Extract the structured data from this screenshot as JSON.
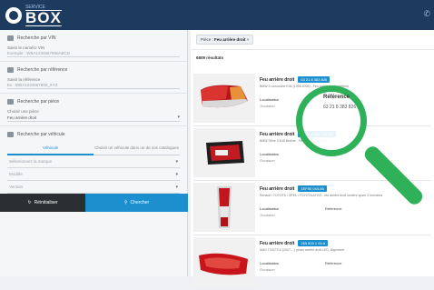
{
  "header": {
    "brand_small": "SERVICE",
    "brand": "BOX",
    "right_icon": "phone-icon"
  },
  "sidebar": {
    "vin": {
      "title": "Recherche par VIN",
      "label": "Saisir le numéro VIN",
      "placeholder": "Exemple : WBA1234567890ABCD"
    },
    "ref": {
      "title": "Recherche par référence",
      "label": "Saisir la référence",
      "placeholder": "Ex : WBA1234567890_XYZ"
    },
    "piece": {
      "title": "Recherche par pièce",
      "label": "Choisir une pièce",
      "value": "Feu arrière droit"
    },
    "vehicle": {
      "title": "Recherche par véhicule",
      "tabs": [
        "Véhicule",
        "Choisir un véhicule dans un de vos catalogues"
      ],
      "brand_placeholder": "Sélectionnez la marque",
      "model_placeholder": "Modèle",
      "version_placeholder": "Version"
    },
    "reset_label": "Réinitialiser",
    "search_label": "Chercher"
  },
  "main": {
    "filter_prefix": "Pièce :",
    "filter_value": "Feu arrière droit",
    "results_title": "6809 résultats",
    "results": [
      {
        "title": "Feu arrière droit",
        "ref": "63 21 8 383 826",
        "desc": "BMW 3 Limousine E46 (1998-2005) - Feu arrière droit extérieur",
        "loc_label": "Localisation",
        "loc_value": "Occasion",
        "ref_label": "Référence"
      },
      {
        "title": "Feu arrière droit",
        "ref": "63 21 8 364 725 BE",
        "desc": "BMW Série 3 E46 Berline - Feu arrière droit ext.",
        "loc_label": "Localisation",
        "loc_value": "Occasion",
        "ref_label": "Référence"
      },
      {
        "title": "Feu arrière droit",
        "ref": "1EF90 043-06",
        "desc": "Renault / TOYOTA / OPEL / TOYOTA AYGO - feu arrière droit lumière spare 3 fonctions",
        "loc_label": "Localisation",
        "loc_value": "Occasion",
        "ref_label": "Référence"
      },
      {
        "title": "Feu arrière droit",
        "ref": "265 500 1 00 A",
        "desc": "MAN TGS/TGX (2007-...) phare arrière droit LED, clignotant",
        "loc_label": "Localisation",
        "loc_value": "Occasion",
        "ref_label": "Référence"
      }
    ]
  },
  "magnifier": {
    "label": "Référence",
    "value": "63 21 8 383 826"
  },
  "colors": {
    "header": "#1d3a5f",
    "accent": "#1c8fcf",
    "magnifier": "#2fb15a"
  }
}
